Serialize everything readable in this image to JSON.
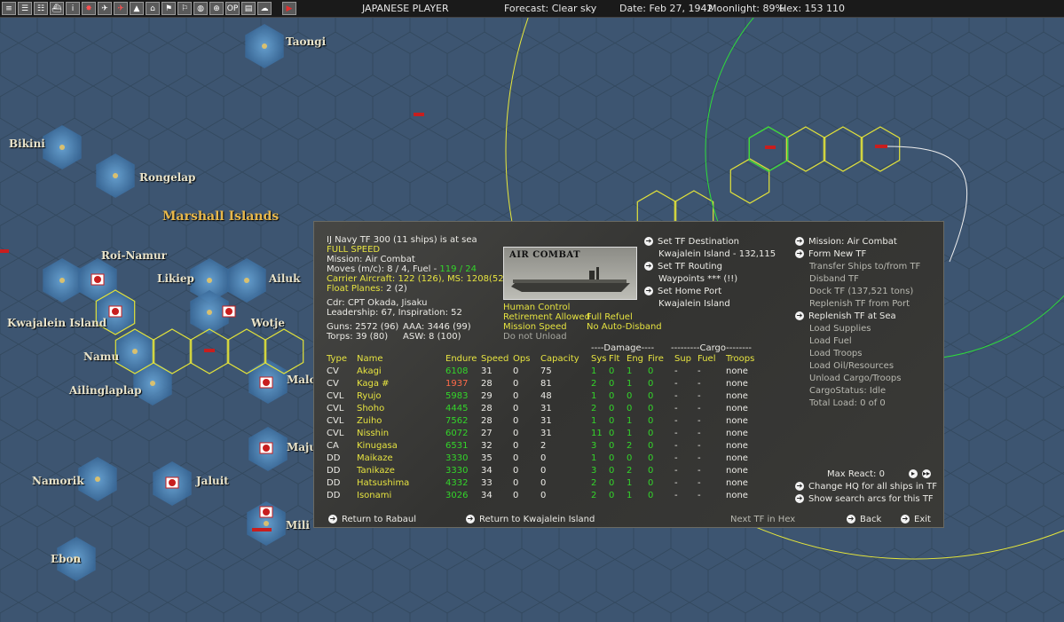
{
  "topbar": {
    "buttons": [
      "menu-icon",
      "list-icon",
      "list2-icon",
      "ship-icon",
      "info-icon",
      "burst-icon",
      "plane-icon",
      "plane2-icon",
      "lcu-icon",
      "base-icon",
      "flag-icon",
      "hq-icon",
      "globe-icon",
      "zoom-icon",
      "op-icon",
      "report-icon",
      "weather-icon",
      "end-turn-icon"
    ],
    "player": "JAPANESE PLAYER",
    "forecast": "Forecast: Clear sky",
    "date": "Date: Feb 27, 1942",
    "moonlight": "Moonlight: 89%",
    "hex": "Hex: 153 110"
  },
  "map": {
    "labels": [
      "Taongi",
      "Bikini",
      "Rongelap",
      "Marshall Islands",
      "Roi-Namur",
      "Likiep",
      "Ailuk",
      "Kwajalein Island",
      "Wotje",
      "Namu",
      "Ailinglaplap",
      "Malo",
      "Maju",
      "Namorik",
      "Jaluit",
      "Ebon",
      "Mili"
    ]
  },
  "panel": {
    "header": "IJ Navy TF 300 (11 ships) is at sea",
    "speed": "FULL SPEED",
    "mission": "Mission: Air Combat",
    "moves_label": "Moves (m/c): 8 / 4, Fuel - ",
    "moves_fuel": "119 / 24",
    "carrier_aircraft": "Carrier Aircraft: 122 (126), MS: 1208(52%)",
    "float_label": "Float Planes: ",
    "float_value": "2 (2)",
    "cdr": "Cdr: CPT Okada, Jisaku",
    "leadership": "Leadership: 67, Inspiration: 52",
    "guns": "Guns: 2572 (96)",
    "aaa": "AAA: 3446 (99)",
    "torps": "Torps: 39 (80)",
    "asw": "ASW: 8 (100)",
    "picture_title": "AIR COMBAT",
    "human_control": "Human Control",
    "retirement": "Retirement Allowed",
    "full_refuel": "Full Refuel",
    "mission_speed": "Mission Speed",
    "no_auto_disband": "No Auto-Disband",
    "do_not_unload": "Do not Unload",
    "nav": {
      "set_destination": "Set TF Destination",
      "destination_value": "Kwajalein Island - 132,115",
      "set_routing": "Set TF Routing",
      "waypoints": "Waypoints *** (!!)",
      "set_home_port": "Set Home Port",
      "home_port_value": "Kwajalein Island"
    },
    "right_menu": {
      "mission": "Mission: Air Combat",
      "form_new_tf": "Form New TF",
      "transfer": "Transfer Ships to/from TF",
      "disband": "Disband TF",
      "dock": "Dock TF (137,521 tons)",
      "replenish_port": "Replenish TF from Port",
      "replenish_sea": "Replenish TF at Sea",
      "load_supplies": "Load Supplies",
      "load_fuel": "Load Fuel",
      "load_troops": "Load Troops",
      "load_oil": "Load Oil/Resources",
      "unload": "Unload Cargo/Troops",
      "cargo_status": "CargoStatus: Idle",
      "total_load": "Total Load: 0 of 0"
    },
    "group_damage": "----Damage----",
    "group_cargo": "---------Cargo--------",
    "columns": [
      "Type",
      "Name",
      "Endure",
      "Speed",
      "Ops",
      "Capacity",
      "Sys",
      "Flt",
      "Eng",
      "Fire",
      "Sup",
      "Fuel",
      "Troops"
    ],
    "ships": [
      {
        "type": "CV",
        "name": "Akagi",
        "endure": "6108",
        "speed": "31",
        "ops": "0",
        "capacity": "75",
        "sys": "1",
        "flt": "0",
        "eng": "1",
        "fire": "0",
        "sup": "-",
        "fuel": "-",
        "troops": "none",
        "ecolor": "g"
      },
      {
        "type": "CV",
        "name": "Kaga #",
        "endure": "1937",
        "speed": "28",
        "ops": "0",
        "capacity": "81",
        "sys": "2",
        "flt": "0",
        "eng": "1",
        "fire": "0",
        "sup": "-",
        "fuel": "-",
        "troops": "none",
        "ecolor": "r"
      },
      {
        "type": "CVL",
        "name": "Ryujo",
        "endure": "5983",
        "speed": "29",
        "ops": "0",
        "capacity": "48",
        "sys": "1",
        "flt": "0",
        "eng": "0",
        "fire": "0",
        "sup": "-",
        "fuel": "-",
        "troops": "none",
        "ecolor": "g"
      },
      {
        "type": "CVL",
        "name": "Shoho",
        "endure": "4445",
        "speed": "28",
        "ops": "0",
        "capacity": "31",
        "sys": "2",
        "flt": "0",
        "eng": "0",
        "fire": "0",
        "sup": "-",
        "fuel": "-",
        "troops": "none",
        "ecolor": "g"
      },
      {
        "type": "CVL",
        "name": "Zuiho",
        "endure": "7562",
        "speed": "28",
        "ops": "0",
        "capacity": "31",
        "sys": "1",
        "flt": "0",
        "eng": "1",
        "fire": "0",
        "sup": "-",
        "fuel": "-",
        "troops": "none",
        "ecolor": "g"
      },
      {
        "type": "CVL",
        "name": "Nisshin",
        "endure": "6072",
        "speed": "27",
        "ops": "0",
        "capacity": "31",
        "sys": "11",
        "flt": "0",
        "eng": "1",
        "fire": "0",
        "sup": "-",
        "fuel": "-",
        "troops": "none",
        "ecolor": "g"
      },
      {
        "type": "CA",
        "name": "Kinugasa",
        "endure": "6531",
        "speed": "32",
        "ops": "0",
        "capacity": "2",
        "sys": "3",
        "flt": "0",
        "eng": "2",
        "fire": "0",
        "sup": "-",
        "fuel": "-",
        "troops": "none",
        "ecolor": "g"
      },
      {
        "type": "DD",
        "name": "Maikaze",
        "endure": "3330",
        "speed": "35",
        "ops": "0",
        "capacity": "0",
        "sys": "1",
        "flt": "0",
        "eng": "0",
        "fire": "0",
        "sup": "-",
        "fuel": "-",
        "troops": "none",
        "ecolor": "g"
      },
      {
        "type": "DD",
        "name": "Tanikaze",
        "endure": "3330",
        "speed": "34",
        "ops": "0",
        "capacity": "0",
        "sys": "3",
        "flt": "0",
        "eng": "2",
        "fire": "0",
        "sup": "-",
        "fuel": "-",
        "troops": "none",
        "ecolor": "g"
      },
      {
        "type": "DD",
        "name": "Hatsushima",
        "endure": "4332",
        "speed": "33",
        "ops": "0",
        "capacity": "0",
        "sys": "2",
        "flt": "0",
        "eng": "1",
        "fire": "0",
        "sup": "-",
        "fuel": "-",
        "troops": "none",
        "ecolor": "g"
      },
      {
        "type": "DD",
        "name": "Isonami",
        "endure": "3026",
        "speed": "34",
        "ops": "0",
        "capacity": "0",
        "sys": "2",
        "flt": "0",
        "eng": "1",
        "fire": "0",
        "sup": "-",
        "fuel": "-",
        "troops": "none",
        "ecolor": "g"
      }
    ],
    "max_react": "Max React: 0",
    "change_hq": "Change HQ for all ships in TF",
    "show_search": "Show search arcs for this TF",
    "return_rabaul": "Return to Rabaul",
    "return_kwajalein": "Return to Kwajalein Island",
    "next_tf": "Next TF in Hex",
    "back": "Back",
    "exit": "Exit"
  },
  "colors": {
    "ocean": "#3c5470",
    "reef": "#4a7fb0",
    "yellow_hex": "#e8e83a",
    "green_circle": "#2edc3a",
    "japan_red": "#c81e1e"
  }
}
